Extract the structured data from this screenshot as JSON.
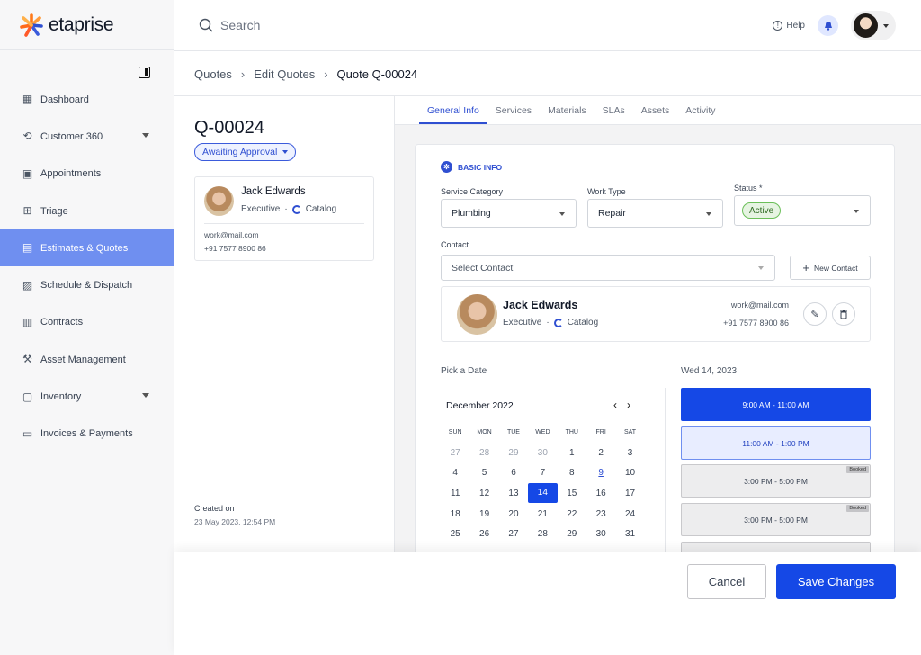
{
  "app": {
    "name": "etaprise"
  },
  "search": {
    "placeholder": "Search"
  },
  "header": {
    "help_label": "Help"
  },
  "sidebar": {
    "items": [
      {
        "label": "Dashboard",
        "icon": "dashboard-icon"
      },
      {
        "label": "Customer 360",
        "icon": "customer-icon",
        "expandable": true
      },
      {
        "label": "Appointments",
        "icon": "calendar-icon"
      },
      {
        "label": "Triage",
        "icon": "triage-icon"
      },
      {
        "label": "Estimates & Quotes",
        "icon": "quote-icon",
        "active": true
      },
      {
        "label": "Schedule & Dispatch",
        "icon": "schedule-icon"
      },
      {
        "label": "Contracts",
        "icon": "contract-icon"
      },
      {
        "label": "Asset Management",
        "icon": "asset-icon"
      },
      {
        "label": "Inventory",
        "icon": "inventory-icon",
        "expandable": true
      },
      {
        "label": "Invoices & Payments",
        "icon": "invoice-icon"
      }
    ]
  },
  "breadcrumb": [
    "Quotes",
    "Edit Quotes",
    "Quote Q-00024"
  ],
  "quote": {
    "id": "Q-00024",
    "status": "Awaiting Approval",
    "created_label": "Created on",
    "created_value": "23 May 2023, 12:54 PM"
  },
  "contact": {
    "name": "Jack Edwards",
    "role": "Executive",
    "company": "Catalog",
    "email": "work@mail.com",
    "phone": "+91 7577 8900 86"
  },
  "tabs": [
    "General Info",
    "Services",
    "Materials",
    "SLAs",
    "Assets",
    "Activity"
  ],
  "basic_info": {
    "title": "BASIC INFO",
    "service_category_label": "Service Category",
    "service_category_value": "Plumbing",
    "work_type_label": "Work Type",
    "work_type_value": "Repair",
    "status_label": "Status *",
    "status_value": "Active",
    "contact_label": "Contact",
    "contact_placeholder": "Select Contact",
    "new_contact_label": "New Contact"
  },
  "schedule": {
    "pick_label": "Pick a Date",
    "selected_day": "Wed 14, 2023",
    "month": "December 2022",
    "weekdays": [
      "SUN",
      "MON",
      "TUE",
      "WED",
      "THU",
      "FRI",
      "SAT"
    ],
    "weeks": [
      [
        "27",
        "28",
        "29",
        "30",
        "1",
        "2",
        "3"
      ],
      [
        "4",
        "5",
        "6",
        "7",
        "8",
        "9",
        "10"
      ],
      [
        "11",
        "12",
        "13",
        "14",
        "15",
        "16",
        "17"
      ],
      [
        "18",
        "19",
        "20",
        "21",
        "22",
        "23",
        "24"
      ],
      [
        "25",
        "26",
        "27",
        "28",
        "29",
        "30",
        "31"
      ]
    ],
    "slots": [
      {
        "label": "9:00 AM - 11:00 AM",
        "state": "selected"
      },
      {
        "label": "11:00 AM - 1:00 PM",
        "state": "highlighted"
      },
      {
        "label": "3:00 PM - 5:00 PM",
        "state": "booked",
        "badge": "Booked"
      },
      {
        "label": "3:00 PM - 5:00 PM",
        "state": "booked",
        "badge": "Booked"
      }
    ]
  },
  "footer": {
    "cancel": "Cancel",
    "save": "Save Changes"
  },
  "colors": {
    "primary": "#1548e6",
    "active_nav": "#6f8ff0",
    "success": "#6bbf59"
  }
}
